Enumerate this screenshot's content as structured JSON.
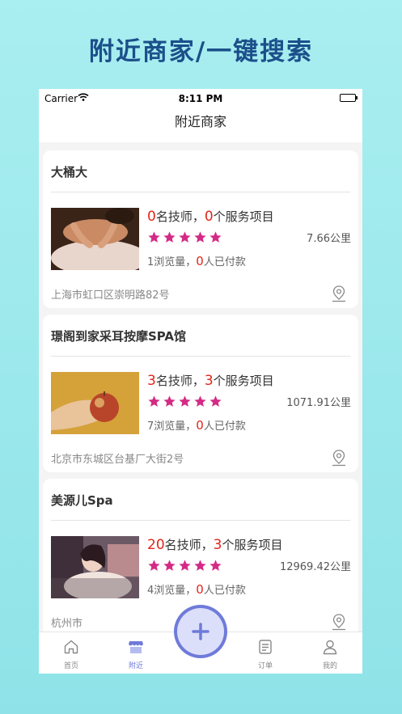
{
  "promo": {
    "title": "附近商家/一键搜索"
  },
  "status": {
    "carrier": "Carrier",
    "time": "8:11 PM"
  },
  "nav": {
    "title": "附近商家"
  },
  "merchants": [
    {
      "name": "大桶大",
      "techs": "0",
      "techs_label": "名技师，",
      "services": "0",
      "services_label": "个服务项目",
      "rating": 5,
      "distance": "7.66公里",
      "views": "1",
      "views_label": "浏览量，",
      "paid": "0",
      "paid_label": "人已付款",
      "address": "上海市虹口区崇明路82号"
    },
    {
      "name": "璟阁到家采耳按摩SPA馆",
      "techs": "3",
      "techs_label": "名技师，",
      "services": "3",
      "services_label": "个服务项目",
      "rating": 5,
      "distance": "1071.91公里",
      "views": "7",
      "views_label": "浏览量，",
      "paid": "0",
      "paid_label": "人已付款",
      "address": "北京市东城区台基厂大街2号"
    },
    {
      "name": "美源儿Spa",
      "techs": "20",
      "techs_label": "名技师，",
      "services": "3",
      "services_label": "个服务项目",
      "rating": 5,
      "distance": "12969.42公里",
      "views": "4",
      "views_label": "浏览量，",
      "paid": "0",
      "paid_label": "人已付款",
      "address": "杭州市"
    }
  ],
  "tabs": [
    {
      "label": "首页",
      "icon": "home-icon"
    },
    {
      "label": "附近",
      "icon": "shop-icon"
    },
    {
      "label": "",
      "icon": "plus-icon"
    },
    {
      "label": "订单",
      "icon": "order-icon"
    },
    {
      "label": "我的",
      "icon": "user-icon"
    }
  ],
  "colors": {
    "accent": "#6f7bd9",
    "star": "#d42a86",
    "highlight": "#e1251b",
    "promo_title": "#1b4f8a"
  }
}
